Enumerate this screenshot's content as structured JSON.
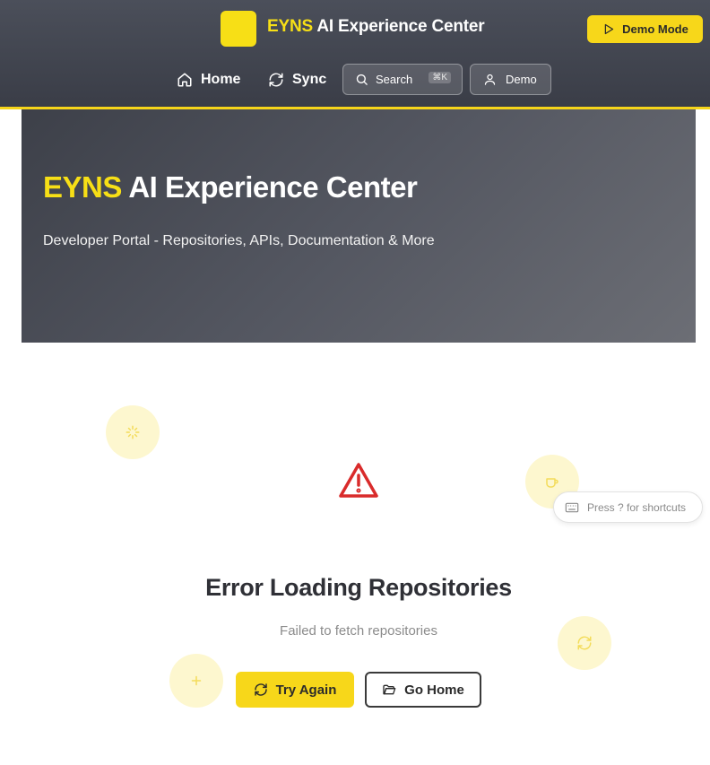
{
  "header": {
    "brand_accent": "EYNS",
    "brand_rest": "AI Experience Center",
    "demo_mode_label": "Demo Mode",
    "nav": {
      "home_label": "Home",
      "sync_label": "Sync",
      "search_label": "Search",
      "search_shortcut": "⌘K",
      "demo_label": "Demo"
    }
  },
  "hero": {
    "title_accent": "EYNS",
    "title_rest": "AI Experience Center",
    "subtitle": "Developer Portal - Repositories, APIs, Documentation & More"
  },
  "error": {
    "title": "Error Loading Repositories",
    "message": "Failed to fetch repositories",
    "try_again_label": "Try Again",
    "go_home_label": "Go Home"
  },
  "shortcut_hint": "Press ? for shortcuts",
  "icons": {
    "home": "home-icon",
    "sync": "refresh-icon",
    "search": "search-icon",
    "user": "user-icon",
    "play": "play-icon",
    "warning": "alert-triangle-icon",
    "keyboard": "keyboard-icon",
    "folder": "folder-open-icon",
    "sparkles": "sparkles-icon",
    "coffee": "coffee-icon",
    "plus": "plus-icon"
  },
  "colors": {
    "accent_yellow": "#f7df16",
    "header_bg": "#3f424c",
    "warning_red": "#d92b2b",
    "deco_bg": "#fdf7cf"
  }
}
